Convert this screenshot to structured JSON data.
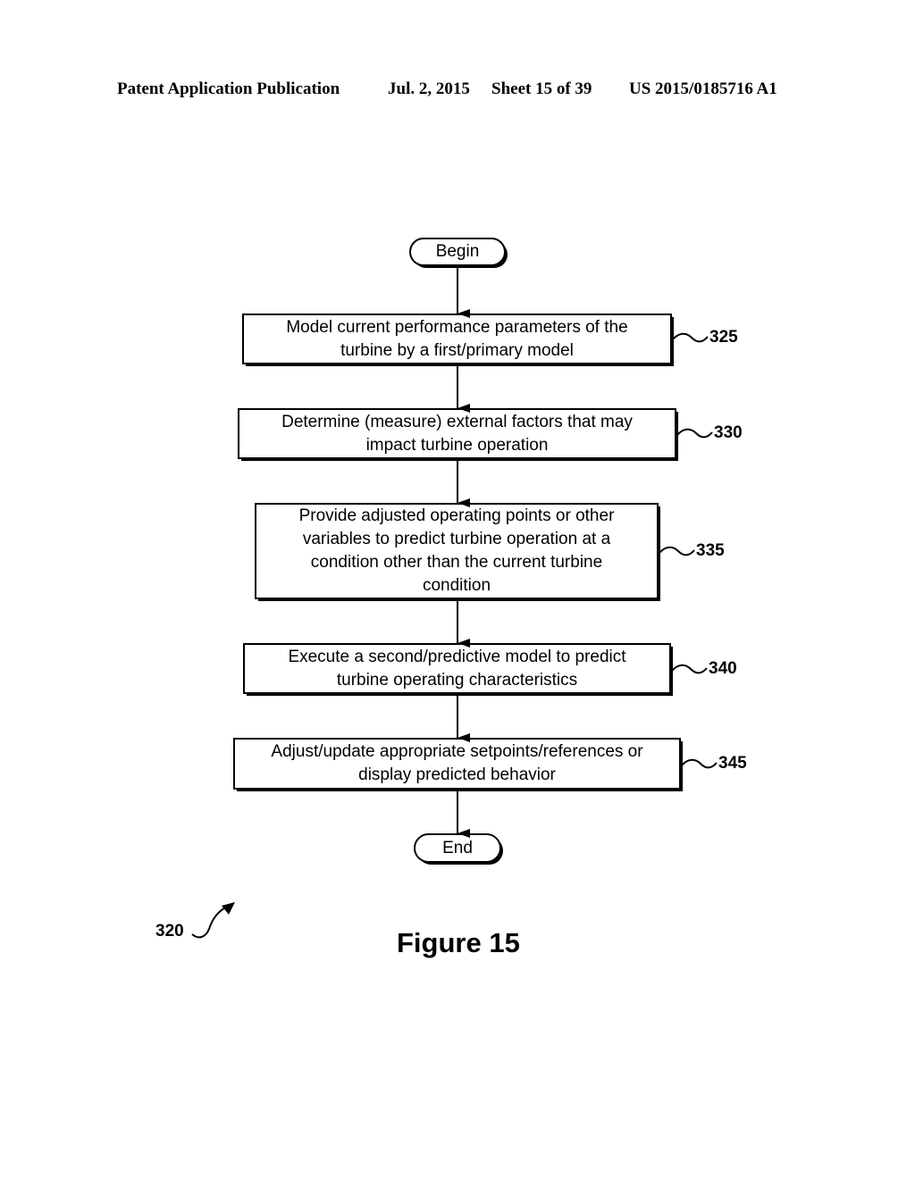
{
  "header": {
    "publication": "Patent Application Publication",
    "date": "Jul. 2, 2015",
    "sheet": "Sheet 15 of 39",
    "number": "US 2015/0185716 A1"
  },
  "flowchart": {
    "begin": "Begin",
    "end": "End",
    "steps": [
      {
        "ref": "325",
        "text": "Model current performance parameters of the turbine by a first/primary model"
      },
      {
        "ref": "330",
        "text": "Determine (measure) external factors that may impact turbine operation"
      },
      {
        "ref": "335",
        "text": "Provide adjusted operating points or other variables to predict turbine operation at a condition other than the current turbine condition"
      },
      {
        "ref": "340",
        "text": "Execute a second/predictive model to predict turbine operating characteristics"
      },
      {
        "ref": "345",
        "text": "Adjust/update appropriate setpoints/references or display predicted behavior"
      }
    ],
    "figure_ref": "320"
  },
  "caption": "Figure 15"
}
